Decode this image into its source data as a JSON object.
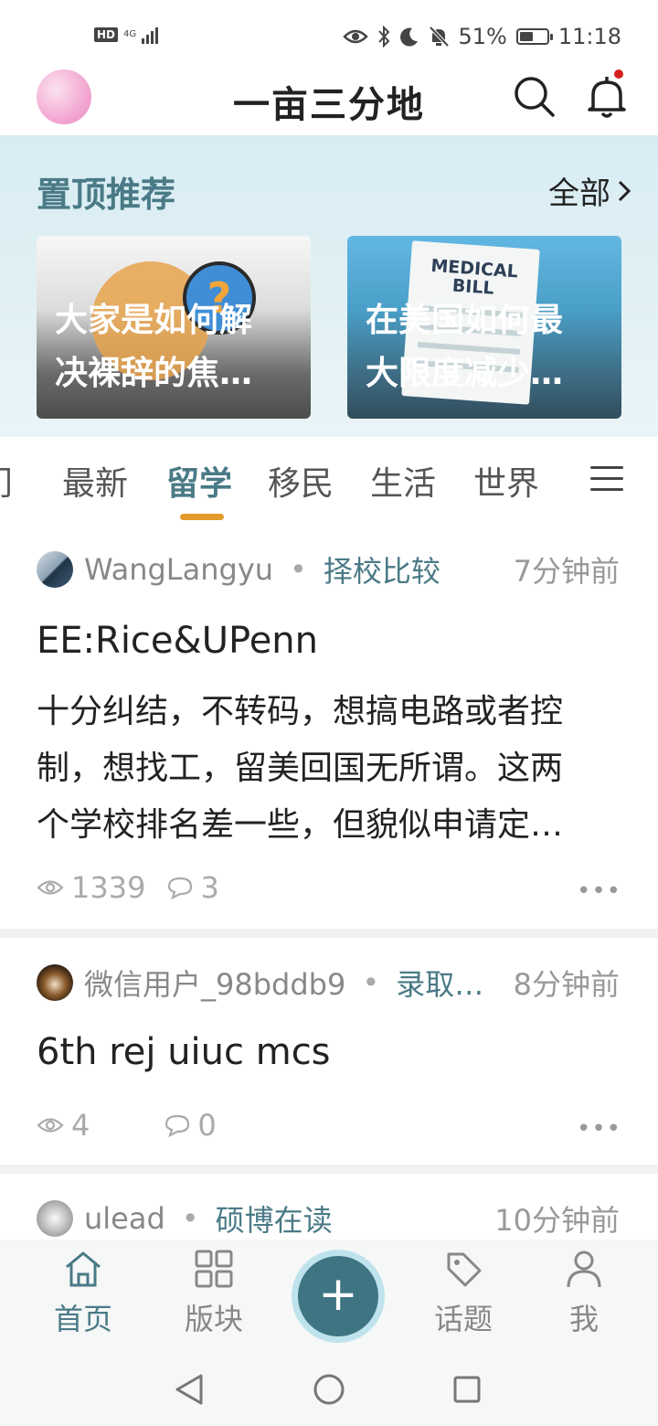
{
  "status_bar": {
    "left_icons": [
      "hd-icon",
      "4g-signal-icon"
    ],
    "hd_label": "HD",
    "network": "4G",
    "battery": "51%",
    "battery_level": 0.51,
    "time": "11:18",
    "right_icons": [
      "eye-icon",
      "bluetooth-icon",
      "moon-icon",
      "mute-bell-icon",
      "battery-icon"
    ]
  },
  "header": {
    "title": "一亩三分地",
    "has_notification_dot": true,
    "notification_dot_color": "#d61e1e"
  },
  "recommended": {
    "title": "置顶推荐",
    "all_label": "全部",
    "cards": [
      {
        "line1": "大家是如何解",
        "line2": "决裸辞的焦…"
      },
      {
        "line1": "在美国如何最",
        "line2": "大限度减少…",
        "image_text_1": "MEDICAL",
        "image_text_2": "BILL"
      }
    ]
  },
  "tabs": {
    "items": [
      "门",
      "最新",
      "留学",
      "移民",
      "生活",
      "世界"
    ],
    "active": "留学",
    "accent_color": "#4a7a86",
    "indicator_color": "#e39a2a"
  },
  "posts": [
    {
      "author": "WangLangyu",
      "topic": "择校比较",
      "time": "7分钟前",
      "title": "EE:Rice&UPenn",
      "body_lines": [
        "十分纠结，不转码，想搞电路或者控",
        "制，想找工，留美回国无所谓。这两",
        "个学校排名差一些，但貌似申请定…"
      ],
      "views": "1339",
      "comments": "3"
    },
    {
      "author": "微信用户_98bddb9",
      "topic": "录取…",
      "time": "8分钟前",
      "title": "6th rej uiuc mcs",
      "views": "4",
      "comments": "0"
    },
    {
      "author": "ulead",
      "topic": "硕博在读",
      "time": "10分钟前"
    }
  ],
  "separator": "•",
  "more_label": "•••",
  "bottom_nav": {
    "items": [
      {
        "label": "首页",
        "icon": "home-icon",
        "active": true
      },
      {
        "label": "版块",
        "icon": "grid-icon",
        "active": false
      },
      {
        "label": "话题",
        "icon": "tag-icon",
        "active": false
      },
      {
        "label": "我",
        "icon": "person-icon",
        "active": false
      }
    ],
    "fab_label": "+"
  }
}
